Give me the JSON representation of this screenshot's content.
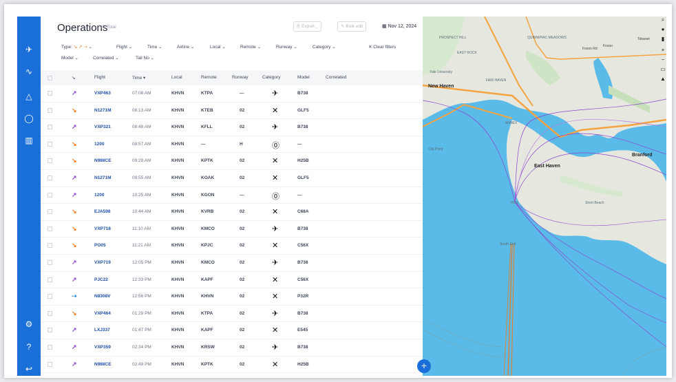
{
  "header": {
    "title": "Operations",
    "count": "27 Total",
    "export_label": "Export",
    "bulk_edit_label": "Bulk edit",
    "date": "Nov 12, 2024"
  },
  "filters": {
    "type": "Type:",
    "type_arrows": "↘ ↗ ⇢",
    "items": [
      "Flight",
      "Time",
      "Airline",
      "Local",
      "Remote",
      "Runway",
      "Category"
    ],
    "row2": [
      "Model",
      "Correlated",
      "Tail No"
    ],
    "clear_label": "Clear filters"
  },
  "table": {
    "headers": [
      "Flight",
      "Time",
      "Local",
      "Remote",
      "Runway",
      "Category",
      "Model",
      "Correlated"
    ],
    "rows": [
      {
        "dir": "↗",
        "dir_color": "#8a44d0",
        "flight": "VXP463",
        "time": "07:08 AM",
        "local": "KHVN",
        "remote": "KTPA",
        "runway": "—",
        "cat": "✈",
        "model": "B738"
      },
      {
        "dir": "↘",
        "dir_color": "#f07a1a",
        "flight": "N1271M",
        "time": "08:13 AM",
        "local": "KHVN",
        "remote": "KTEB",
        "runway": "02",
        "cat": "✕",
        "model": "GLF5"
      },
      {
        "dir": "↗",
        "dir_color": "#8a44d0",
        "flight": "VXP321",
        "time": "08:48 AM",
        "local": "KHVN",
        "remote": "KFLL",
        "runway": "02",
        "cat": "✈",
        "model": "B738"
      },
      {
        "dir": "↘",
        "dir_color": "#f07a1a",
        "flight": "1200",
        "time": "08:57 AM",
        "local": "KHVN",
        "remote": "—",
        "runway": "H",
        "cat": "⓪",
        "model": "—"
      },
      {
        "dir": "↘",
        "dir_color": "#f07a1a",
        "flight": "N988CE",
        "time": "09:29 AM",
        "local": "KHVN",
        "remote": "KPTK",
        "runway": "02",
        "cat": "✕",
        "model": "H25B"
      },
      {
        "dir": "↗",
        "dir_color": "#8a44d0",
        "flight": "N1271M",
        "time": "09:55 AM",
        "local": "KHVN",
        "remote": "KOAK",
        "runway": "02",
        "cat": "✕",
        "model": "GLF5"
      },
      {
        "dir": "↗",
        "dir_color": "#8a44d0",
        "flight": "1200",
        "time": "10:25 AM",
        "local": "KHVN",
        "remote": "KGON",
        "runway": "—",
        "cat": "⓪",
        "model": "—"
      },
      {
        "dir": "↘",
        "dir_color": "#f07a1a",
        "flight": "EJA598",
        "time": "10:44 AM",
        "local": "KHVN",
        "remote": "KVRB",
        "runway": "02",
        "cat": "✕",
        "model": "C68A"
      },
      {
        "dir": "↘",
        "dir_color": "#f07a1a",
        "flight": "VXP718",
        "time": "11:10 AM",
        "local": "KHVN",
        "remote": "KMCO",
        "runway": "02",
        "cat": "✈",
        "model": "B738"
      },
      {
        "dir": "↘",
        "dir_color": "#f07a1a",
        "flight": "PO05",
        "time": "11:21 AM",
        "local": "KHVN",
        "remote": "KPJC",
        "runway": "02",
        "cat": "✕",
        "model": "C56X"
      },
      {
        "dir": "↗",
        "dir_color": "#8a44d0",
        "flight": "VXP719",
        "time": "12:05 PM",
        "local": "KHVN",
        "remote": "KMCO",
        "runway": "02",
        "cat": "✈",
        "model": "B738"
      },
      {
        "dir": "↗",
        "dir_color": "#8a44d0",
        "flight": "PJC22",
        "time": "12:33 PM",
        "local": "KHVN",
        "remote": "KAPF",
        "runway": "02",
        "cat": "✕",
        "model": "C56X"
      },
      {
        "dir": "⇢",
        "dir_color": "#2a8ce0",
        "flight": "N8308V",
        "time": "12:56 PM",
        "local": "KHVN",
        "remote": "KHVN",
        "runway": "02",
        "cat": "✕",
        "model": "P32R"
      },
      {
        "dir": "↘",
        "dir_color": "#f07a1a",
        "flight": "VXP464",
        "time": "01:29 PM",
        "local": "KHVN",
        "remote": "KTPA",
        "runway": "02",
        "cat": "✈",
        "model": "B738"
      },
      {
        "dir": "↗",
        "dir_color": "#8a44d0",
        "flight": "LXJ337",
        "time": "01:47 PM",
        "local": "KHVN",
        "remote": "KAPF",
        "runway": "02",
        "cat": "✕",
        "model": "E545"
      },
      {
        "dir": "↗",
        "dir_color": "#8a44d0",
        "flight": "VXP359",
        "time": "02:34 PM",
        "local": "KHVN",
        "remote": "KRSW",
        "runway": "02",
        "cat": "✈",
        "model": "B738"
      },
      {
        "dir": "↗",
        "dir_color": "#8a44d0",
        "flight": "N988CE",
        "time": "02:49 PM",
        "local": "KHVN",
        "remote": "KPTK",
        "runway": "02",
        "cat": "✕",
        "model": "H25B"
      }
    ]
  },
  "map": {
    "labels": [
      "PROSPECT HILL",
      "QUINNIPIAC MEADOWS",
      "EAST ROCK",
      "Yale University",
      "FAIR HAVEN",
      "ANNEX",
      "City Point",
      "South End",
      "Short Beach",
      "HVN"
    ],
    "cities": [
      "New Haven",
      "East Haven",
      "Branford"
    ],
    "roads": [
      "Tobanet",
      "Foxon Rd",
      "Foxon"
    ]
  },
  "rail_icons": [
    "plane-icon",
    "activity-icon",
    "alert-icon",
    "chat-icon",
    "chart-icon",
    "settings-icon",
    "help-icon",
    "logout-icon"
  ],
  "colors": {
    "accent": "#1a6fd8",
    "water": "#5bbbe8",
    "arrival": "#f07a1a",
    "departure": "#8a44d0"
  }
}
